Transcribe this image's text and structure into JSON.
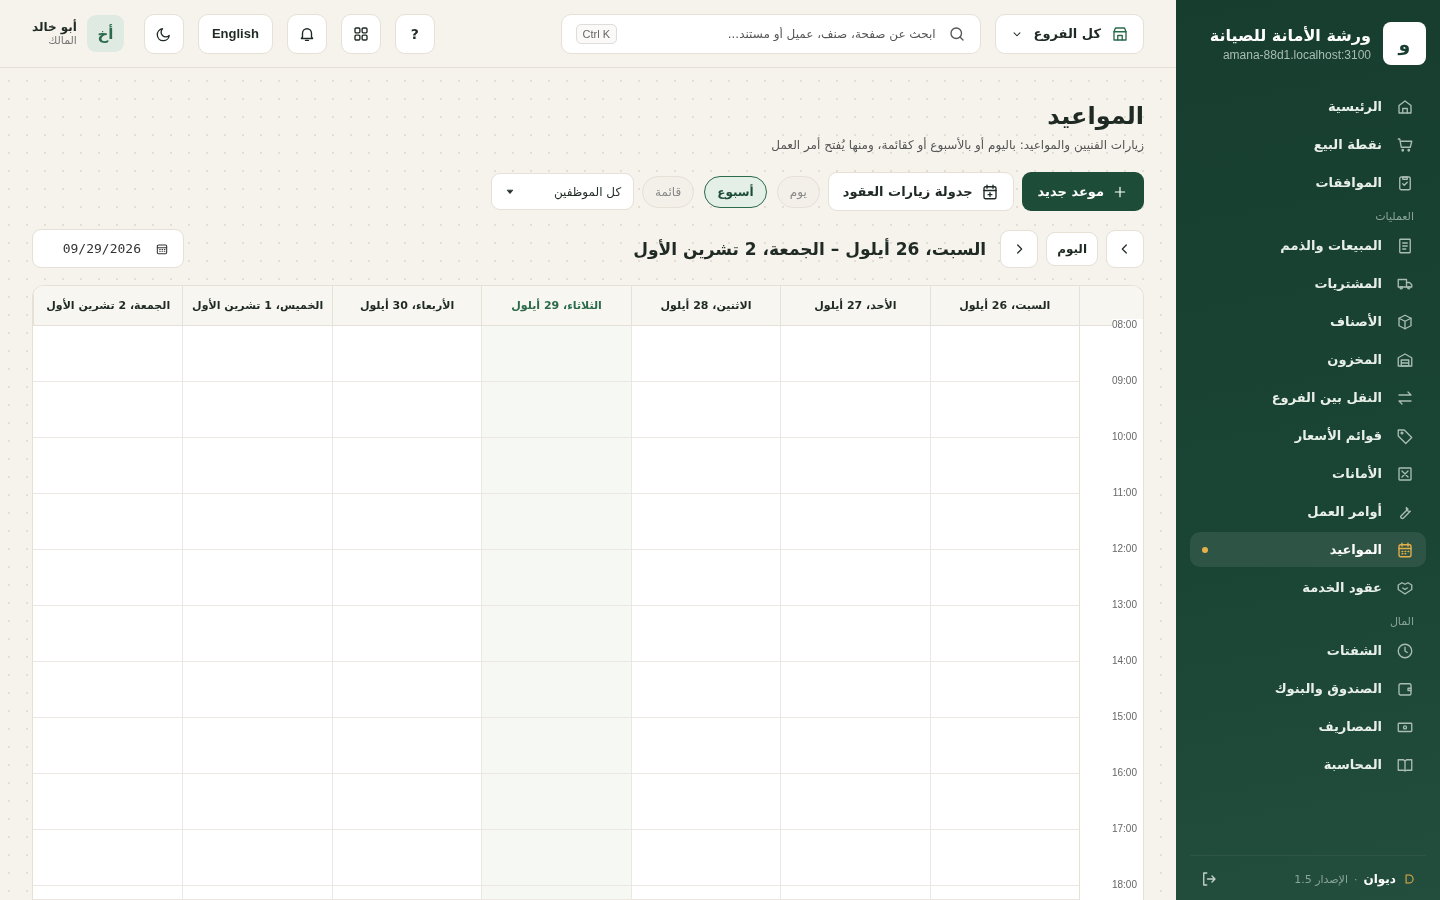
{
  "sidebar": {
    "logo": "و",
    "name": "ورشة الأمانة للصيانة",
    "host": "amana-88d1.localhost:3100",
    "sections": [
      {
        "items": [
          {
            "label": "الرئيسية",
            "selected": false
          },
          {
            "label": "نقطة البيع",
            "selected": false
          },
          {
            "label": "الموافقات",
            "selected": false
          }
        ]
      },
      {
        "label": "العمليات",
        "items": [
          {
            "label": "المبيعات والذمم",
            "selected": false
          },
          {
            "label": "المشتريات",
            "selected": false
          },
          {
            "label": "الأصناف",
            "selected": false
          },
          {
            "label": "المخزون",
            "selected": false
          },
          {
            "label": "النقل بين الفروع",
            "selected": false
          },
          {
            "label": "قوائم الأسعار",
            "selected": false
          },
          {
            "label": "الأمانات",
            "selected": false
          },
          {
            "label": "أوامر العمل",
            "selected": false
          },
          {
            "label": "المواعيد",
            "selected": true
          },
          {
            "label": "عقود الخدمة",
            "selected": false
          }
        ]
      },
      {
        "label": "المال",
        "items": [
          {
            "label": "الشفتات",
            "selected": false
          },
          {
            "label": "الصندوق والبنوك",
            "selected": false
          },
          {
            "label": "المصاريف",
            "selected": false
          },
          {
            "label": "المحاسبة",
            "selected": false
          }
        ]
      }
    ],
    "footer": {
      "brand": "ديوان",
      "separator": "·",
      "version": "الإصدار 1.5"
    }
  },
  "topbar": {
    "branch": "كل الفروع",
    "search_placeholder": "ابحث عن صفحة، صنف، عميل أو مستند...",
    "shortcut": "Ctrl K",
    "help": "?",
    "language": "English",
    "avatar": "أخ",
    "user_name": "أبو خالد",
    "user_role": "المالك"
  },
  "page": {
    "title": "المواعيد",
    "subtitle": "زيارات الفنيين والمواعيد: باليوم أو بالأسبوع أو كقائمة، ومنها يُفتح أمر العمل",
    "new_button": "موعد جديد",
    "schedule_button": "جدولة زيارات العقود",
    "views": [
      {
        "label": "يوم",
        "selected": false
      },
      {
        "label": "أسبوع",
        "selected": true
      },
      {
        "label": "قائمة",
        "selected": false
      }
    ],
    "employee_filter": "كل الموظفين",
    "today_button": "اليوم",
    "range": "السبت، 26 أيلول – الجمعة، 2 تشرين الأول",
    "date": "09/29/2026"
  },
  "calendar": {
    "days": [
      {
        "label": "السبت، 26 أيلول",
        "today": false
      },
      {
        "label": "الأحد، 27 أيلول",
        "today": false
      },
      {
        "label": "الاثنين، 28 أيلول",
        "today": false
      },
      {
        "label": "الثلاثاء، 29 أيلول",
        "today": true
      },
      {
        "label": "الأربعاء، 30 أيلول",
        "today": false
      },
      {
        "label": "الخميس، 1 تشرين الأول",
        "today": false
      },
      {
        "label": "الجمعة، 2 تشرين الأول",
        "today": false
      }
    ],
    "times": [
      "08:00",
      "09:00",
      "10:00",
      "11:00",
      "12:00",
      "13:00",
      "14:00",
      "15:00",
      "16:00",
      "17:00",
      "18:00"
    ]
  }
}
